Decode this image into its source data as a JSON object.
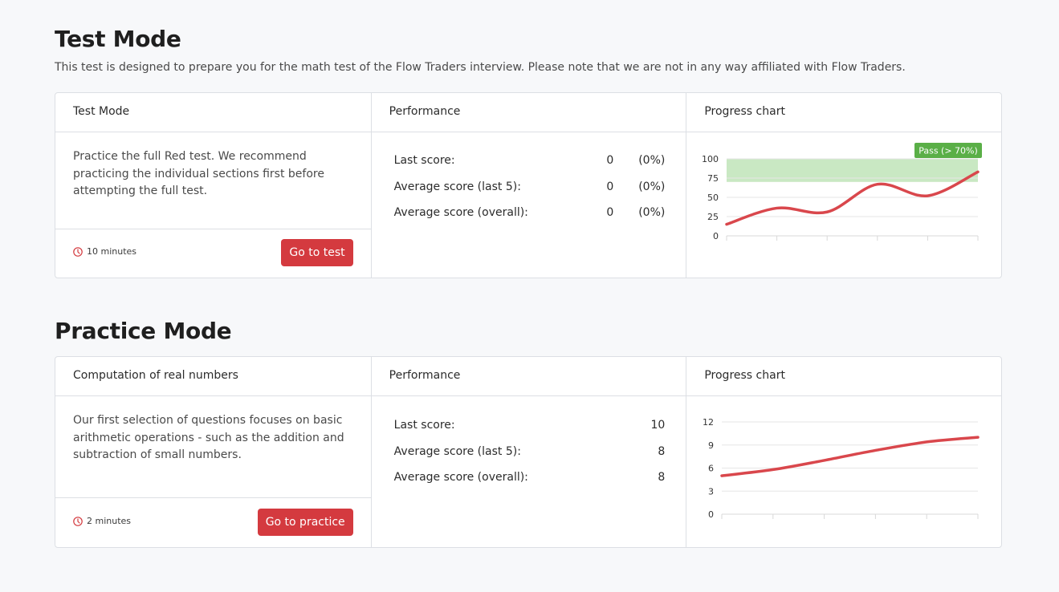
{
  "test": {
    "heading": "Test Mode",
    "subtitle": "This test is designed to prepare you for the math test of the Flow Traders interview. Please note that we are not in any way affiliated with Flow Traders.",
    "card": {
      "col1_title": "Test Mode",
      "description": "Practice the full Red test. We recommend practicing the individual sections first before attempting the full test.",
      "time": "10 minutes",
      "button": "Go to test",
      "col2_title": "Performance",
      "rows": [
        {
          "label": "Last score:",
          "value": "0",
          "pct": "(0%)"
        },
        {
          "label": "Average score (last 5):",
          "value": "0",
          "pct": "(0%)"
        },
        {
          "label": "Average score (overall):",
          "value": "0",
          "pct": "(0%)"
        }
      ],
      "col3_title": "Progress chart"
    }
  },
  "practice": {
    "heading": "Practice Mode",
    "card": {
      "col1_title": "Computation of real numbers",
      "description": "Our first selection of questions focuses on basic arithmetic operations - such as the addition and subtraction of small numbers.",
      "time": "2 minutes",
      "button": "Go to practice",
      "col2_title": "Performance",
      "rows": [
        {
          "label": "Last score:",
          "value": "10"
        },
        {
          "label": "Average score (last 5):",
          "value": "8"
        },
        {
          "label": "Average score (overall):",
          "value": "8"
        }
      ],
      "col3_title": "Progress chart"
    }
  },
  "colors": {
    "accent": "#d43a3f",
    "pass_band": "#c9e8c3",
    "pass_badge": "#5aaf47"
  },
  "chart_data": [
    {
      "type": "line",
      "ylim": [
        0,
        100
      ],
      "yticks": [
        0,
        25,
        50,
        75,
        100
      ],
      "pass_band": [
        70,
        100
      ],
      "pass_label": "Pass (> 70%)",
      "x": [
        0,
        1,
        2,
        3,
        4,
        5
      ],
      "series": [
        {
          "values": [
            15,
            36,
            31,
            67,
            52,
            83
          ]
        }
      ]
    },
    {
      "type": "line",
      "ylim": [
        0,
        12
      ],
      "yticks": [
        0,
        3,
        6,
        9,
        12
      ],
      "x": [
        0,
        1,
        2,
        3,
        4,
        5
      ],
      "series": [
        {
          "values": [
            5,
            5.8,
            7,
            8.3,
            9.4,
            10
          ]
        }
      ]
    }
  ]
}
